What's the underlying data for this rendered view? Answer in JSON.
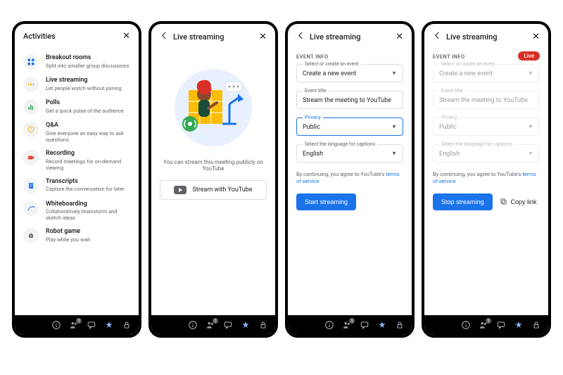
{
  "panel1": {
    "title": "Activities",
    "items": [
      {
        "title": "Breakout rooms",
        "desc": "Split into smaller group discussions",
        "icon": "breakout"
      },
      {
        "title": "Live streaming",
        "desc": "Let people watch without joining",
        "icon": "live"
      },
      {
        "title": "Polls",
        "desc": "Get a quick pulse of the audience",
        "icon": "polls"
      },
      {
        "title": "Q&A",
        "desc": "Give everyone an easy way to ask questions",
        "icon": "qa"
      },
      {
        "title": "Recording",
        "desc": "Record meetings for on-demand viewing",
        "icon": "record"
      },
      {
        "title": "Transcripts",
        "desc": "Capture the conversation for later",
        "icon": "transcript"
      },
      {
        "title": "Whiteboarding",
        "desc": "Collaboratively brainstorm and sketch ideas",
        "icon": "whiteboard"
      },
      {
        "title": "Robot game",
        "desc": "Play while you wait",
        "icon": "robot"
      }
    ]
  },
  "panel2": {
    "title": "Live streaming",
    "caption": "You can stream this meeting publicly on YouTube",
    "button": "Stream with YouTube"
  },
  "panel3": {
    "title": "Live streaming",
    "section": "EVENT INFO",
    "event_select": {
      "label": "Select or create an event",
      "value": "Create a new event"
    },
    "event_title": {
      "label": "Event title",
      "value": "Stream the meeting to YouTube"
    },
    "privacy": {
      "label": "Privacy",
      "value": "Public"
    },
    "language": {
      "label": "Select the language for captions",
      "value": "English"
    },
    "terms_prefix": "By continuing, you agree to YouTube's ",
    "terms_link": "terms of service",
    "button": "Start streaming"
  },
  "panel4": {
    "title": "Live streaming",
    "live_badge": "Live",
    "section": "EVENT INFO",
    "event_select": {
      "label": "Select or create an event",
      "value": "Create a new event"
    },
    "event_title": {
      "label": "Event title",
      "value": "Stream the meeting to YouTube"
    },
    "privacy": {
      "label": "Privacy",
      "value": "Public"
    },
    "language": {
      "label": "Select the language for captions",
      "value": "English"
    },
    "terms_prefix": "By continuing, you agree to YouTube's ",
    "terms_link": "terms of service",
    "button": "Stop streaming",
    "copy": "Copy link"
  },
  "bottombar": {
    "people_count": "1"
  }
}
